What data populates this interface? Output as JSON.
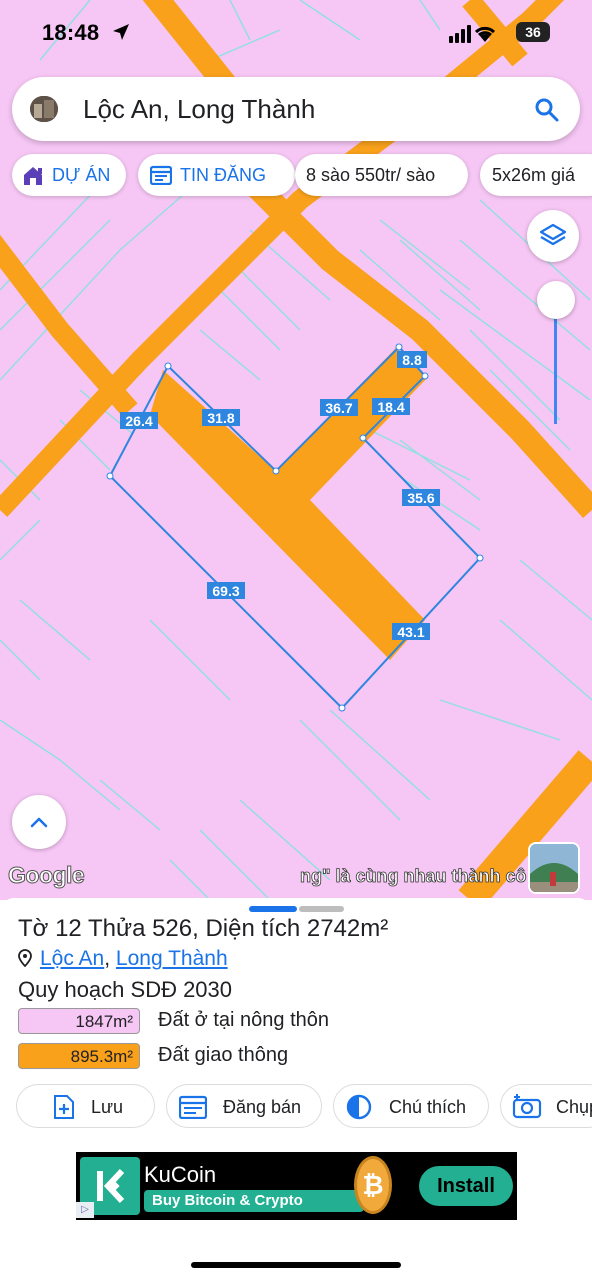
{
  "status_bar": {
    "time": "18:48",
    "battery": "36"
  },
  "search": {
    "query": "Lộc An, Long Thành"
  },
  "chips": [
    {
      "label": "DỰ ÁN"
    },
    {
      "label": "TIN ĐĂNG"
    },
    {
      "label": "8 sào 550tr/ sào"
    },
    {
      "label": "5x26m giá"
    }
  ],
  "map": {
    "dimensions": [
      "26.4",
      "31.8",
      "36.7",
      "8.8",
      "18.4",
      "35.6",
      "69.3",
      "43.1"
    ],
    "attribution": "Google",
    "marquee": "ng\" là cùng nhau thành cô",
    "colors": {
      "residential": "#f6c6f4",
      "road": "#f9a11b",
      "boundary": "#2e86de"
    }
  },
  "sheet": {
    "title": "Tờ 12 Thửa 526, Diện tích 2742m²",
    "ward": "Lộc An",
    "separator": ",",
    "district": "Long Thành",
    "plan_title": "Quy hoạch SDĐ 2030",
    "legend": [
      {
        "value": "1847m²",
        "label": "Đất ở tại nông thôn",
        "color": "#f6c6f4"
      },
      {
        "value": "895.3m²",
        "label": "Đất giao thông",
        "color": "#f9a11b"
      }
    ],
    "actions": [
      {
        "label": "Lưu"
      },
      {
        "label": "Đăng bán"
      },
      {
        "label": "Chú thích"
      },
      {
        "label": "Chụp"
      }
    ]
  },
  "ad": {
    "brand": "KuCoin",
    "subtitle": "Buy Bitcoin & Crypto",
    "coin_symbol": "₿",
    "install_label": "Install"
  }
}
